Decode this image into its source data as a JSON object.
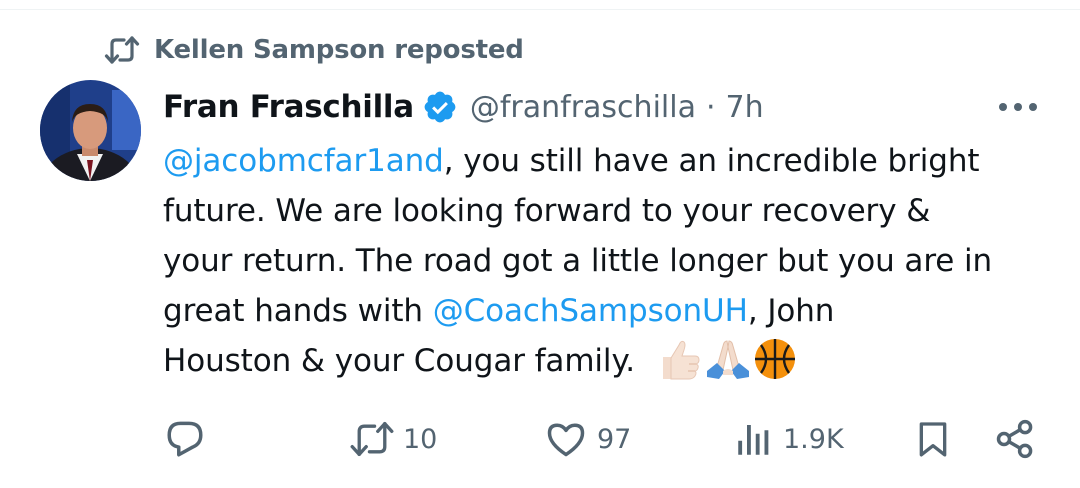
{
  "repost": {
    "text": "Kellen Sampson reposted",
    "icon": "repost-icon"
  },
  "author": {
    "display_name": "Fran Fraschilla",
    "handle": "@franfraschilla",
    "separator": "·",
    "time": "7h",
    "verified": true,
    "verified_color": "#1d9bf0"
  },
  "tweet": {
    "line1_mention": "@jacobmcfar1and",
    "line1_rest": ", you still have an incredible bright",
    "line2": "future. We are looking forward to your recovery &",
    "line3": "your return. The road got a little longer but you are in",
    "line4_pre": "great hands with ",
    "line4_mention": "@CoachSampsonUH",
    "line4_post": ", John",
    "line5": "Houston & your Cougar family.",
    "emojis": [
      "thumbs-up-emoji",
      "folded-hands-emoji",
      "basketball-emoji"
    ]
  },
  "actions": {
    "reply": {
      "icon": "reply-icon",
      "count": ""
    },
    "repost": {
      "icon": "repost-icon",
      "count": "10"
    },
    "like": {
      "icon": "heart-icon",
      "count": "97"
    },
    "views": {
      "icon": "views-icon",
      "count": "1.9K"
    },
    "bookmark": {
      "icon": "bookmark-icon"
    },
    "share": {
      "icon": "share-icon"
    }
  },
  "colors": {
    "text": "#0f1419",
    "secondary": "#536471",
    "link": "#1d9bf0"
  }
}
